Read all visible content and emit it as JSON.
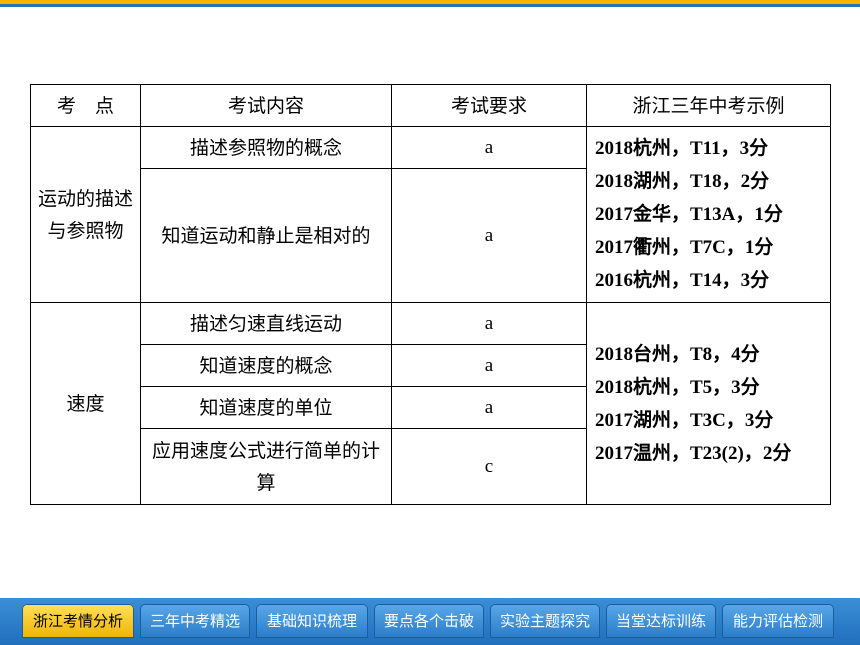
{
  "table": {
    "headers": [
      "考　点",
      "考试内容",
      "考试要求",
      "浙江三年中考示例"
    ],
    "groups": [
      {
        "topic": "运动的描述与参照物",
        "rows": [
          {
            "content": "描述参照物的概念",
            "requirement": "a"
          },
          {
            "content": "知道运动和静止是相对的",
            "requirement": "a"
          }
        ],
        "examples": [
          "2018杭州，T11，3分",
          "2018湖州，T18，2分",
          "2017金华，T13A，1分",
          "2017衢州，T7C，1分",
          "2016杭州，T14，3分"
        ]
      },
      {
        "topic": "速度",
        "rows": [
          {
            "content": "描述匀速直线运动",
            "requirement": "a"
          },
          {
            "content": "知道速度的概念",
            "requirement": "a"
          },
          {
            "content": "知道速度的单位",
            "requirement": "a"
          },
          {
            "content": "应用速度公式进行简单的计算",
            "requirement": "c"
          }
        ],
        "examples": [
          "2018台州，T8，4分",
          "2018杭州，T5，3分",
          "2017湖州，T3C，3分",
          "2017温州，T23(2)，2分"
        ]
      }
    ]
  },
  "nav": {
    "tabs": [
      "浙江考情分析",
      "三年中考精选",
      "基础知识梳理",
      "要点各个击破",
      "实验主题探究",
      "当堂达标训练",
      "能力评估检测"
    ],
    "active_index": 0
  },
  "colors": {
    "accent_gold": "#f2b400",
    "accent_blue": "#2f6fb0",
    "nav_blue": "#1f6fbd"
  }
}
